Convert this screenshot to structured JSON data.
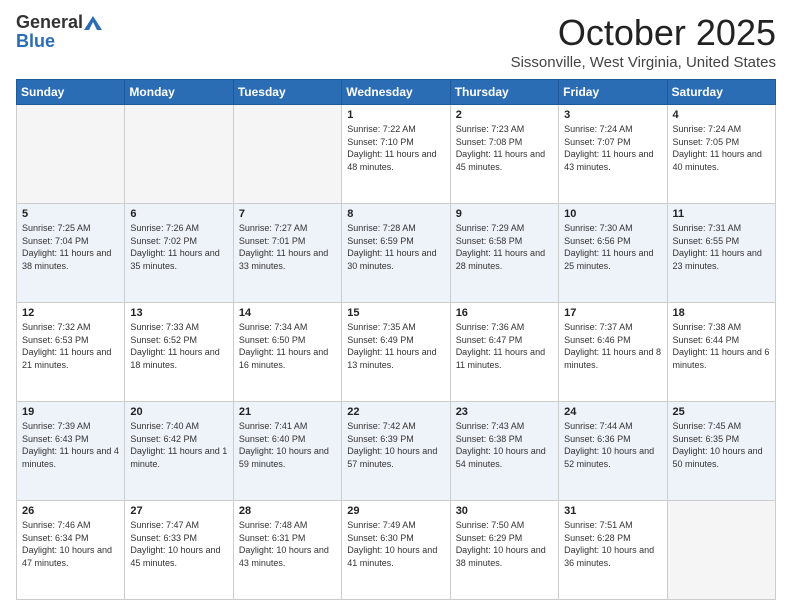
{
  "header": {
    "logo_general": "General",
    "logo_blue": "Blue",
    "month_title": "October 2025",
    "subtitle": "Sissonville, West Virginia, United States"
  },
  "days_of_week": [
    "Sunday",
    "Monday",
    "Tuesday",
    "Wednesday",
    "Thursday",
    "Friday",
    "Saturday"
  ],
  "weeks": [
    [
      {
        "day": "",
        "info": ""
      },
      {
        "day": "",
        "info": ""
      },
      {
        "day": "",
        "info": ""
      },
      {
        "day": "1",
        "info": "Sunrise: 7:22 AM\nSunset: 7:10 PM\nDaylight: 11 hours and 48 minutes."
      },
      {
        "day": "2",
        "info": "Sunrise: 7:23 AM\nSunset: 7:08 PM\nDaylight: 11 hours and 45 minutes."
      },
      {
        "day": "3",
        "info": "Sunrise: 7:24 AM\nSunset: 7:07 PM\nDaylight: 11 hours and 43 minutes."
      },
      {
        "day": "4",
        "info": "Sunrise: 7:24 AM\nSunset: 7:05 PM\nDaylight: 11 hours and 40 minutes."
      }
    ],
    [
      {
        "day": "5",
        "info": "Sunrise: 7:25 AM\nSunset: 7:04 PM\nDaylight: 11 hours and 38 minutes."
      },
      {
        "day": "6",
        "info": "Sunrise: 7:26 AM\nSunset: 7:02 PM\nDaylight: 11 hours and 35 minutes."
      },
      {
        "day": "7",
        "info": "Sunrise: 7:27 AM\nSunset: 7:01 PM\nDaylight: 11 hours and 33 minutes."
      },
      {
        "day": "8",
        "info": "Sunrise: 7:28 AM\nSunset: 6:59 PM\nDaylight: 11 hours and 30 minutes."
      },
      {
        "day": "9",
        "info": "Sunrise: 7:29 AM\nSunset: 6:58 PM\nDaylight: 11 hours and 28 minutes."
      },
      {
        "day": "10",
        "info": "Sunrise: 7:30 AM\nSunset: 6:56 PM\nDaylight: 11 hours and 25 minutes."
      },
      {
        "day": "11",
        "info": "Sunrise: 7:31 AM\nSunset: 6:55 PM\nDaylight: 11 hours and 23 minutes."
      }
    ],
    [
      {
        "day": "12",
        "info": "Sunrise: 7:32 AM\nSunset: 6:53 PM\nDaylight: 11 hours and 21 minutes."
      },
      {
        "day": "13",
        "info": "Sunrise: 7:33 AM\nSunset: 6:52 PM\nDaylight: 11 hours and 18 minutes."
      },
      {
        "day": "14",
        "info": "Sunrise: 7:34 AM\nSunset: 6:50 PM\nDaylight: 11 hours and 16 minutes."
      },
      {
        "day": "15",
        "info": "Sunrise: 7:35 AM\nSunset: 6:49 PM\nDaylight: 11 hours and 13 minutes."
      },
      {
        "day": "16",
        "info": "Sunrise: 7:36 AM\nSunset: 6:47 PM\nDaylight: 11 hours and 11 minutes."
      },
      {
        "day": "17",
        "info": "Sunrise: 7:37 AM\nSunset: 6:46 PM\nDaylight: 11 hours and 8 minutes."
      },
      {
        "day": "18",
        "info": "Sunrise: 7:38 AM\nSunset: 6:44 PM\nDaylight: 11 hours and 6 minutes."
      }
    ],
    [
      {
        "day": "19",
        "info": "Sunrise: 7:39 AM\nSunset: 6:43 PM\nDaylight: 11 hours and 4 minutes."
      },
      {
        "day": "20",
        "info": "Sunrise: 7:40 AM\nSunset: 6:42 PM\nDaylight: 11 hours and 1 minute."
      },
      {
        "day": "21",
        "info": "Sunrise: 7:41 AM\nSunset: 6:40 PM\nDaylight: 10 hours and 59 minutes."
      },
      {
        "day": "22",
        "info": "Sunrise: 7:42 AM\nSunset: 6:39 PM\nDaylight: 10 hours and 57 minutes."
      },
      {
        "day": "23",
        "info": "Sunrise: 7:43 AM\nSunset: 6:38 PM\nDaylight: 10 hours and 54 minutes."
      },
      {
        "day": "24",
        "info": "Sunrise: 7:44 AM\nSunset: 6:36 PM\nDaylight: 10 hours and 52 minutes."
      },
      {
        "day": "25",
        "info": "Sunrise: 7:45 AM\nSunset: 6:35 PM\nDaylight: 10 hours and 50 minutes."
      }
    ],
    [
      {
        "day": "26",
        "info": "Sunrise: 7:46 AM\nSunset: 6:34 PM\nDaylight: 10 hours and 47 minutes."
      },
      {
        "day": "27",
        "info": "Sunrise: 7:47 AM\nSunset: 6:33 PM\nDaylight: 10 hours and 45 minutes."
      },
      {
        "day": "28",
        "info": "Sunrise: 7:48 AM\nSunset: 6:31 PM\nDaylight: 10 hours and 43 minutes."
      },
      {
        "day": "29",
        "info": "Sunrise: 7:49 AM\nSunset: 6:30 PM\nDaylight: 10 hours and 41 minutes."
      },
      {
        "day": "30",
        "info": "Sunrise: 7:50 AM\nSunset: 6:29 PM\nDaylight: 10 hours and 38 minutes."
      },
      {
        "day": "31",
        "info": "Sunrise: 7:51 AM\nSunset: 6:28 PM\nDaylight: 10 hours and 36 minutes."
      },
      {
        "day": "",
        "info": ""
      }
    ]
  ]
}
